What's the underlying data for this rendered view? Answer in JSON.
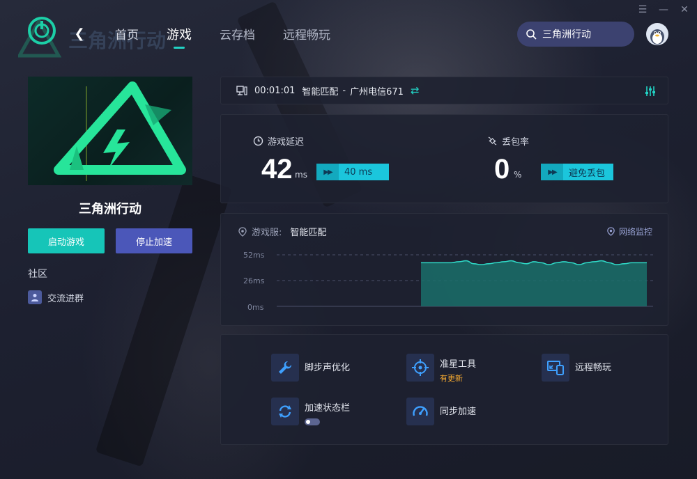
{
  "window": {
    "menu_icon": "menu-icon",
    "minimize_icon": "minimize-icon",
    "close_icon": "close-icon"
  },
  "header": {
    "logo_text": "三角洲行动",
    "nav": [
      {
        "label": "首页"
      },
      {
        "label": "游戏"
      },
      {
        "label": "云存档"
      },
      {
        "label": "远程畅玩"
      }
    ],
    "search_text": "三角洲行动"
  },
  "game": {
    "title": "三角洲行动",
    "start_label": "启动游戏",
    "stop_label": "停止加速",
    "community_label": "社区",
    "group_label": "交流进群"
  },
  "status": {
    "timer": "00:01:01",
    "mode": "智能匹配",
    "sep": "-",
    "node": "广州电信671"
  },
  "stats": {
    "latency_label": "游戏延迟",
    "latency_value": "42",
    "latency_unit": "ms",
    "latency_badge": "40 ms",
    "loss_label": "丢包率",
    "loss_value": "0",
    "loss_unit": "%",
    "loss_badge": "避免丢包"
  },
  "chart": {
    "server_label": "游戏服:",
    "server_value": "智能匹配",
    "monitor_label": "网络监控",
    "ticks": [
      "52ms",
      "26ms",
      "0ms"
    ]
  },
  "chart_data": {
    "type": "area",
    "ylim": [
      0,
      52
    ],
    "yticks": [
      "52ms",
      "26ms",
      "0ms"
    ],
    "x": [
      0,
      1,
      2,
      3,
      4,
      5,
      6,
      7,
      8,
      9,
      10,
      11,
      12,
      13,
      14,
      15,
      16,
      17,
      18,
      19,
      20,
      21,
      22,
      23,
      24,
      25,
      26,
      27,
      28,
      29,
      30
    ],
    "series": [
      {
        "values": [
          44,
          44,
          44,
          44,
          44,
          45,
          46,
          43,
          42,
          43,
          44,
          45,
          46,
          44,
          43,
          45,
          44,
          42,
          44,
          45,
          44,
          42,
          44,
          45,
          46,
          44,
          42,
          43,
          44,
          44,
          44
        ]
      }
    ]
  },
  "tools": [
    {
      "label": "脚步声优化",
      "icon": "wrench-icon"
    },
    {
      "label": "准星工具",
      "sub": "有更新",
      "icon": "crosshair-icon"
    },
    {
      "label": "远程畅玩",
      "icon": "remote-screen-icon"
    },
    {
      "label": "加速状态栏",
      "icon": "refresh-icon",
      "toggle": false
    },
    {
      "label": "同步加速",
      "icon": "gauge-icon"
    }
  ],
  "colors": {
    "accent": "#16c5b8",
    "stop_button": "#4b57b9",
    "badge": "#1bc6dc",
    "chart_fill": "#1a6f6a",
    "chart_line": "#2fd8c6",
    "update": "#f0a630"
  }
}
